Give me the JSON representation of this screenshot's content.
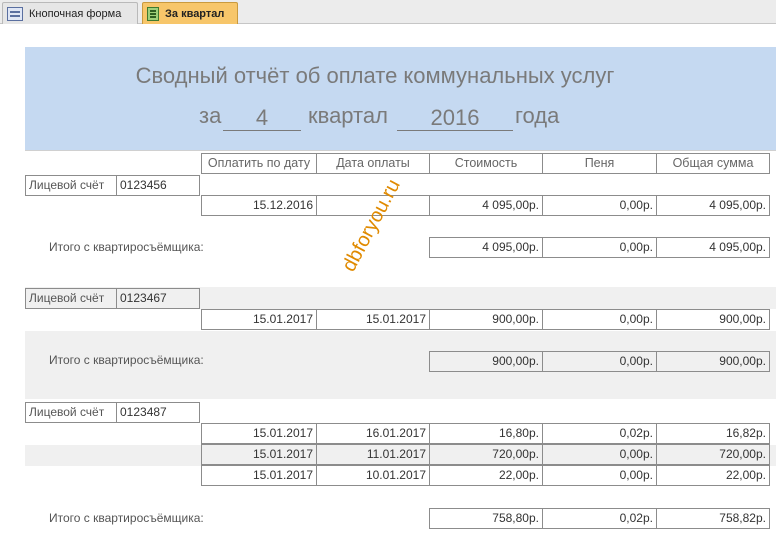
{
  "tabs": [
    {
      "label": "Кнопочная форма",
      "active": false
    },
    {
      "label": "За квартал",
      "active": true
    }
  ],
  "report": {
    "title": "Сводный отчёт об оплате коммунальных услуг",
    "period_prefix": "за",
    "quarter": "4",
    "quarter_word": "квартал",
    "year": "2016",
    "year_word": "года",
    "columns": [
      "Оплатить по дату",
      "Дата оплаты",
      "Стоимость",
      "Пеня",
      "Общая сумма"
    ],
    "account_label": "Лицевой счёт",
    "total_label": "Итого с квартиросъёмщика:",
    "groups": [
      {
        "account": "0123456",
        "rows": [
          {
            "due": "15.12.2016",
            "paid": "",
            "cost": "4 095,00р.",
            "penalty": "0,00р.",
            "total": "4 095,00р."
          }
        ],
        "totals": {
          "cost": "4 095,00р.",
          "penalty": "0,00р.",
          "total": "4 095,00р."
        }
      },
      {
        "account": "0123467",
        "rows": [
          {
            "due": "15.01.2017",
            "paid": "15.01.2017",
            "cost": "900,00р.",
            "penalty": "0,00р.",
            "total": "900,00р."
          }
        ],
        "totals": {
          "cost": "900,00р.",
          "penalty": "0,00р.",
          "total": "900,00р."
        }
      },
      {
        "account": "0123487",
        "rows": [
          {
            "due": "15.01.2017",
            "paid": "16.01.2017",
            "cost": "16,80р.",
            "penalty": "0,02р.",
            "total": "16,82р."
          },
          {
            "due": "15.01.2017",
            "paid": "11.01.2017",
            "cost": "720,00р.",
            "penalty": "0,00р.",
            "total": "720,00р."
          },
          {
            "due": "15.01.2017",
            "paid": "10.01.2017",
            "cost": "22,00р.",
            "penalty": "0,00р.",
            "total": "22,00р."
          }
        ],
        "totals": {
          "cost": "758,80р.",
          "penalty": "0,02р.",
          "total": "758,82р."
        }
      }
    ]
  },
  "watermark": "dbforyou.ru"
}
